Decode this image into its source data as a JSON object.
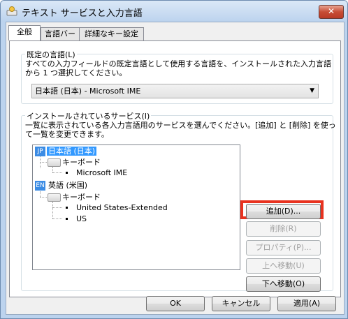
{
  "window": {
    "title": "テキスト サービスと入力言語",
    "close_label": "✕"
  },
  "tabs": [
    "全般",
    "言語バー",
    "詳細なキー設定"
  ],
  "default_language": {
    "group_label": "既定の言語(L)",
    "description_line1": "すべての入力フィールドの既定言語として使用する言語を、インストールされた入力言語",
    "description_line2": "から 1 つ選択してください。",
    "selected": "日本語 (日本) - Microsoft IME"
  },
  "installed_services": {
    "group_label": "インストールされているサービス(I)",
    "description_line1": "一覧に表示されている各入力言語用のサービスを選んでください。[追加] と [削除] を使っ",
    "description_line2": "て一覧を変更できます。",
    "tree": {
      "jp_badge": "JP",
      "jp_label": "日本語 (日本)",
      "jp_keyboard": "キーボード",
      "jp_ime": "Microsoft IME",
      "en_badge": "EN",
      "en_label": "英語 (米国)",
      "en_keyboard": "キーボード",
      "en_layout1": "United States-Extended",
      "en_layout2": "US"
    },
    "buttons": {
      "add": "追加(D)...",
      "remove": "削除(R)",
      "properties": "プロパティ(P)...",
      "move_up": "上へ移動(U)",
      "move_down": "下へ移動(O)"
    }
  },
  "footer": {
    "ok": "OK",
    "cancel": "キャンセル",
    "apply": "適用(A)"
  },
  "colors": {
    "highlight": "#e8321f",
    "selection": "#3399ff"
  }
}
